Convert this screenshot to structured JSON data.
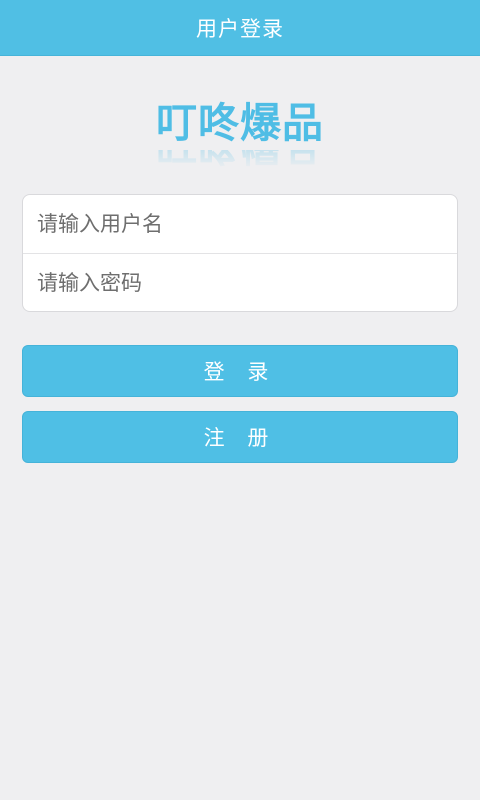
{
  "header": {
    "title": "用户登录"
  },
  "logo": {
    "text": "叮咚爆品"
  },
  "form": {
    "username_placeholder": "请输入用户名",
    "password_placeholder": "请输入密码"
  },
  "buttons": {
    "login_label": "登 录",
    "register_label": "注 册"
  },
  "colors": {
    "accent": "#50bfe4",
    "background": "#efeff1"
  }
}
